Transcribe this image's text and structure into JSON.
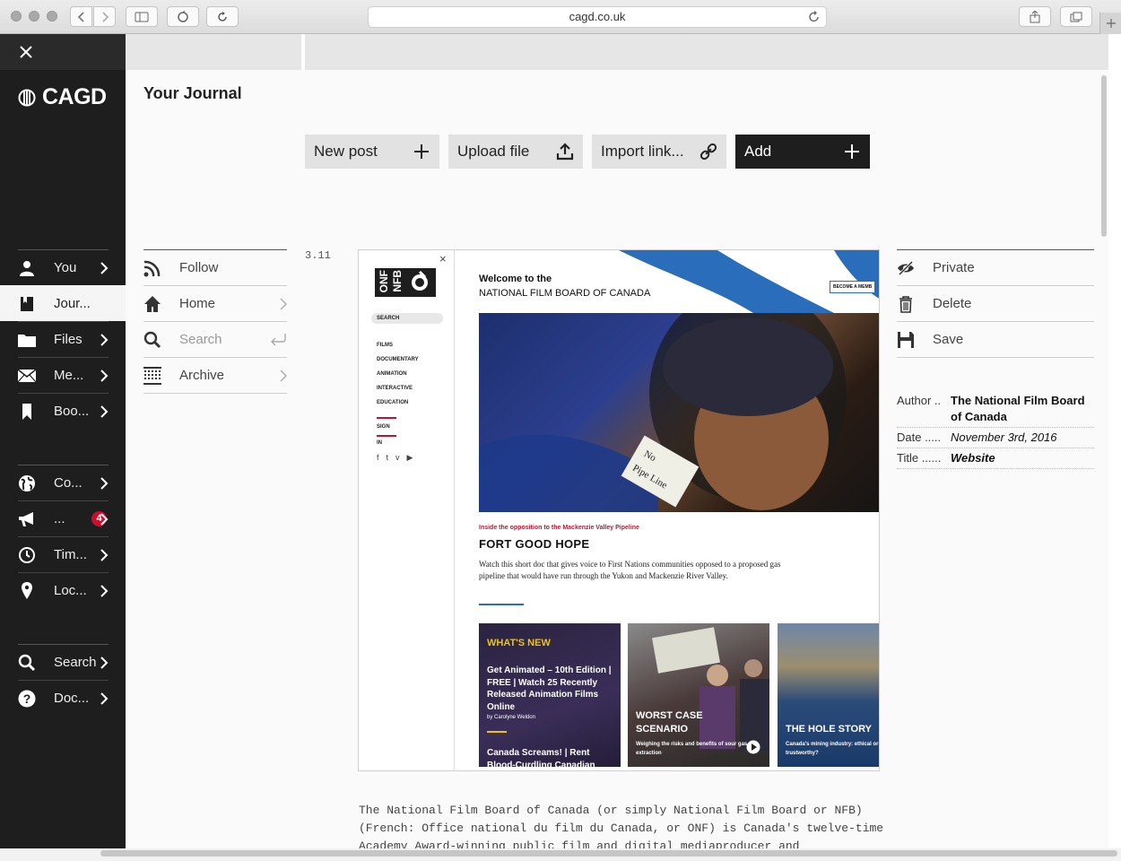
{
  "browser": {
    "url": "cagd.co.uk"
  },
  "sidebar": {
    "logo": "CAGD",
    "items_top": [
      {
        "label": "You",
        "icon": "user-icon"
      },
      {
        "label": "Jour...",
        "icon": "journal-icon",
        "active": true
      },
      {
        "label": "Files",
        "icon": "folder-icon"
      },
      {
        "label": "Me...",
        "icon": "envelope-icon"
      },
      {
        "label": "Boo...",
        "icon": "bookmark-icon"
      }
    ],
    "items_mid": [
      {
        "label": "Co...",
        "icon": "globe-icon"
      },
      {
        "label": "...",
        "icon": "megaphone-icon",
        "badge": "4"
      },
      {
        "label": "Tim...",
        "icon": "clock-icon"
      },
      {
        "label": "Loc...",
        "icon": "location-pin-icon"
      }
    ],
    "items_bottom": [
      {
        "label": "Search",
        "icon": "search-icon"
      },
      {
        "label": "Doc...",
        "icon": "help-icon"
      }
    ]
  },
  "main": {
    "title": "Your Journal",
    "toolbar": {
      "new_post": "New post",
      "upload_file": "Upload file",
      "import_link": "Import link...",
      "add": "Add"
    },
    "left_nav": {
      "follow": "Follow",
      "home": "Home",
      "search": "Search",
      "archive": "Archive"
    },
    "post": {
      "date": "3.11",
      "actions": {
        "private": "Private",
        "delete": "Delete",
        "save": "Save"
      },
      "meta": {
        "author_key": "Author ..",
        "author": "The National Film Board of Canada",
        "date_key": "Date .....",
        "date": "November 3rd, 2016",
        "title_key": "Title ......",
        "title": "Website"
      },
      "description": "The National Film Board of Canada (or simply National Film Board or NFB) (French: Office national du film du Canada, or ONF) is Canada's twelve-time Academy Award-winning public film and digital mediaproducer and"
    },
    "screenshot": {
      "close": "×",
      "search": "SEARCH",
      "menu": [
        "FILMS",
        "DOCUMENTARY",
        "ANIMATION",
        "INTERACTIVE",
        "EDUCATION"
      ],
      "sign_in": "SIGN IN",
      "welcome_line1": "Welcome to the",
      "welcome_line2": "NATIONAL FILM BOARD OF CANADA",
      "become_member": "BECOME A MEMB",
      "sign_text": "No Pipe Line",
      "kicker": "Inside the opposition to the Mackenzie Valley Pipeline",
      "film_title": "FORT GOOD HOPE",
      "film_desc": "Watch this short doc that gives voice to First Nations communities opposed to a proposed gas pipeline that would have run through the Yukon and Mackenzie River Valley.",
      "cards": [
        {
          "heading": "WHAT'S NEW",
          "text": "Get Animated – 10th Edition | FREE | Watch 25 Recently Released Animation Films Online",
          "byline": "by Carolyne Weldon",
          "text2": "Canada Screams! | Rent Blood-Curdling Canadian"
        },
        {
          "heading": "WORST CASE SCENARIO",
          "text": "Weighing the risks and benefits of sour gas extraction"
        },
        {
          "heading": "THE HOLE STORY",
          "text": "Canada's mining industry: ethical or trustworthy?"
        }
      ]
    }
  }
}
